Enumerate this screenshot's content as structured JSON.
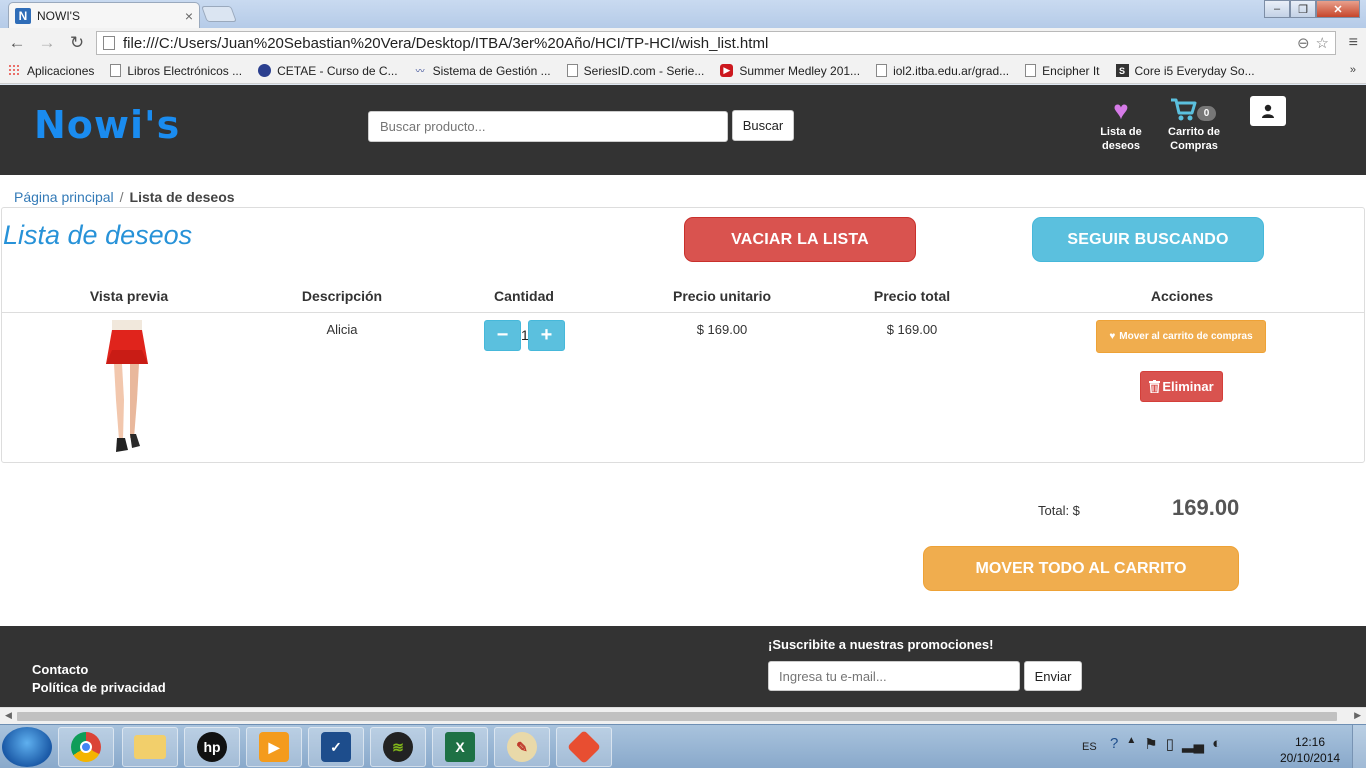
{
  "browser": {
    "tab_title": "NOWI'S",
    "tab_favicon": "N",
    "url": "file:///C:/Users/Juan%20Sebastian%20Vera/Desktop/ITBA/3er%20Año/HCI/TP-HCI/wish_list.html",
    "bookmarks": [
      {
        "label": "Aplicaciones",
        "icon": "apps-grid-icon"
      },
      {
        "label": "Libros Electrónicos ...",
        "icon": "file-icon"
      },
      {
        "label": "CETAE - Curso de C...",
        "icon": "globe-icon"
      },
      {
        "label": "Sistema de Gestión ...",
        "icon": "wave-icon"
      },
      {
        "label": "SeriesID.com - Serie...",
        "icon": "file-icon"
      },
      {
        "label": "Summer Medley 201...",
        "icon": "youtube-icon"
      },
      {
        "label": "iol2.itba.edu.ar/grad...",
        "icon": "file-icon"
      },
      {
        "label": "Encipher It",
        "icon": "file-icon"
      },
      {
        "label": "Core i5 Everyday So...",
        "icon": "s-icon"
      }
    ]
  },
  "header": {
    "logo": "Nowi's",
    "search_placeholder": "Buscar producto...",
    "search_button": "Buscar",
    "wishlist_label": "Lista de deseos",
    "cart_label": "Carrito de Compras",
    "cart_count": "0"
  },
  "breadcrumb": {
    "home": "Página principal",
    "separator": "/",
    "current": "Lista de deseos"
  },
  "wishlist": {
    "title": "Lista de deseos",
    "empty_button": "VACIAR LA LISTA",
    "continue_button": "SEGUIR BUSCANDO",
    "columns": [
      "Vista previa",
      "Descripción",
      "Cantidad",
      "Precio unitario",
      "Precio total",
      "Acciones"
    ],
    "items": [
      {
        "description": "Alicia",
        "quantity": "1",
        "unit_price": "$ 169.00",
        "total_price": "$ 169.00",
        "move_button": "Mover al carrito de compras",
        "delete_button": "Eliminar"
      }
    ],
    "total_label": "Total: $",
    "total_value": "169.00",
    "move_all_button": "MOVER TODO AL CARRITO"
  },
  "footer": {
    "links": [
      "Contacto",
      "Política de privacidad"
    ],
    "promo_title": "¡Suscribite a nuestras promociones!",
    "email_placeholder": "Ingresa tu e-mail...",
    "send_button": "Enviar"
  },
  "taskbar": {
    "language": "ES",
    "time": "12:16",
    "date": "20/10/2014"
  },
  "colors": {
    "header_bg": "#333333",
    "logo": "#1a8cf0",
    "danger": "#d9534f",
    "info": "#5bc0de",
    "warning": "#f0ad4e",
    "title": "#2792d8"
  }
}
